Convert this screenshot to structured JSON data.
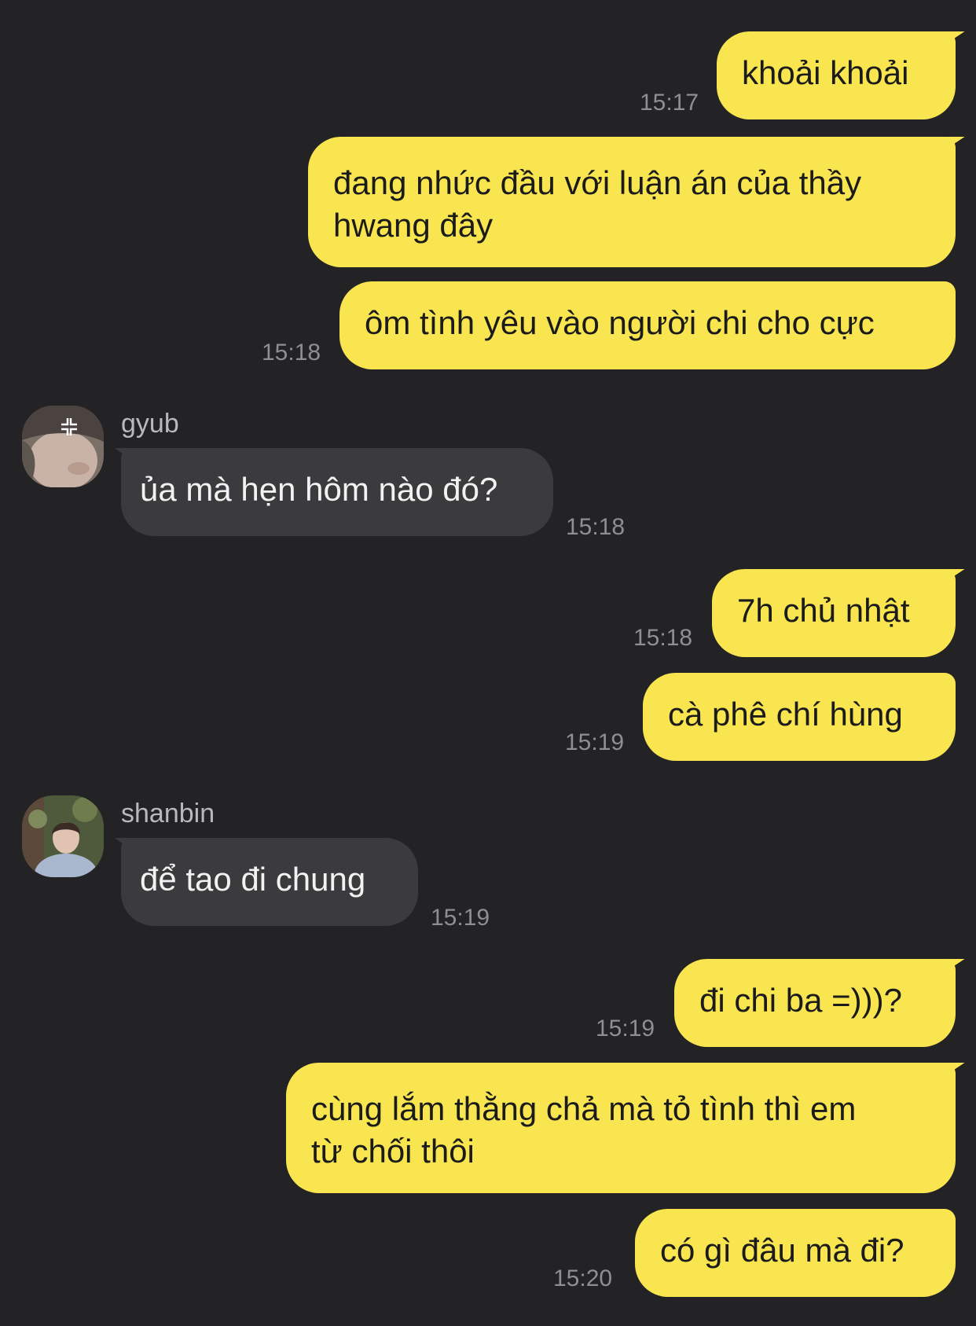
{
  "colors": {
    "background": "#232325",
    "outgoing_bubble": "#f8e550",
    "incoming_bubble": "#3b3b3d",
    "timestamp": "#8e8e93",
    "sender_name": "#b9b9bc"
  },
  "messages": [
    {
      "direction": "out",
      "text": "khoải khoải",
      "time": "15:17"
    },
    {
      "direction": "out",
      "text_line1": "đang nhức đầu với luận án của thầy",
      "text_line2": "hwang đây"
    },
    {
      "direction": "out",
      "text": "ôm tình yêu vào người chi cho cực",
      "time": "15:18"
    },
    {
      "direction": "in",
      "sender": "gyub",
      "avatar_icon": "avatar-photo-gyub",
      "text": "ủa mà hẹn hôm nào đó?",
      "time": "15:18"
    },
    {
      "direction": "out",
      "text": "7h chủ nhật",
      "time": "15:18"
    },
    {
      "direction": "out",
      "text": "cà phê chí hùng",
      "time": "15:19"
    },
    {
      "direction": "in",
      "sender": "shanbin",
      "avatar_icon": "avatar-photo-shanbin",
      "text": "để tao đi chung",
      "time": "15:19"
    },
    {
      "direction": "out",
      "text": "đi chi ba =)))?",
      "time": "15:19"
    },
    {
      "direction": "out",
      "text_line1": "cùng lắm thằng chả mà tỏ tình thì em",
      "text_line2": "từ chối thôi"
    },
    {
      "direction": "out",
      "text": "có gì đâu mà đi?",
      "time": "15:20"
    }
  ]
}
